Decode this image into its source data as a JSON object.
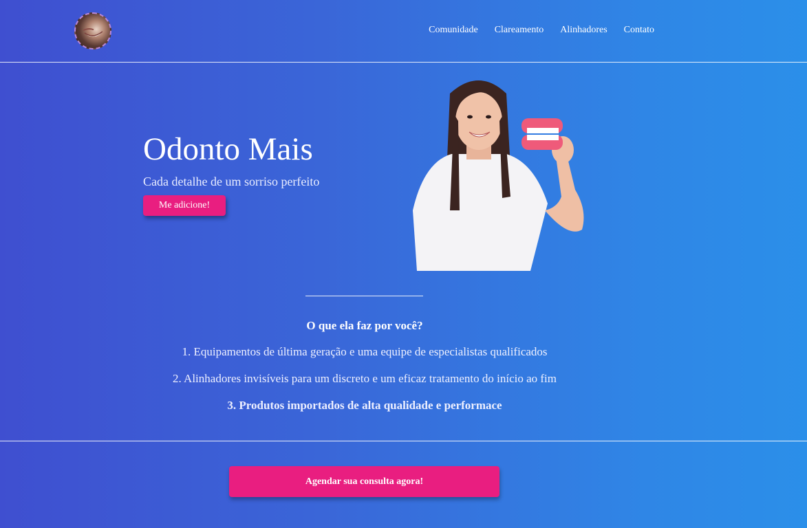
{
  "header": {
    "logo_icon": "smile-logo-icon",
    "nav": [
      {
        "label": "Comunidade"
      },
      {
        "label": "Clareamento"
      },
      {
        "label": "Alinhadores"
      },
      {
        "label": "Contato"
      }
    ]
  },
  "hero": {
    "title": "Odonto Mais",
    "subtitle": "Cada detalhe de um sorriso perfeito",
    "button_label": "Me adicione!",
    "image_icon": "woman-holding-dental-model-image"
  },
  "features": {
    "heading": "O que ela faz por você?",
    "items": [
      "1. Equipamentos de última geração e uma equipe de especialistas qualificados",
      "2. Alinhadores invisíveis para um discreto e um eficaz tratamento do início ao fim",
      "3. Produtos importados de alta qualidade e performace"
    ]
  },
  "cta": {
    "button_label": "Agendar sua consulta agora!"
  },
  "colors": {
    "accent": "#e91e80",
    "gradient_start": "#3f4fd0",
    "gradient_end": "#2b8fe9"
  }
}
